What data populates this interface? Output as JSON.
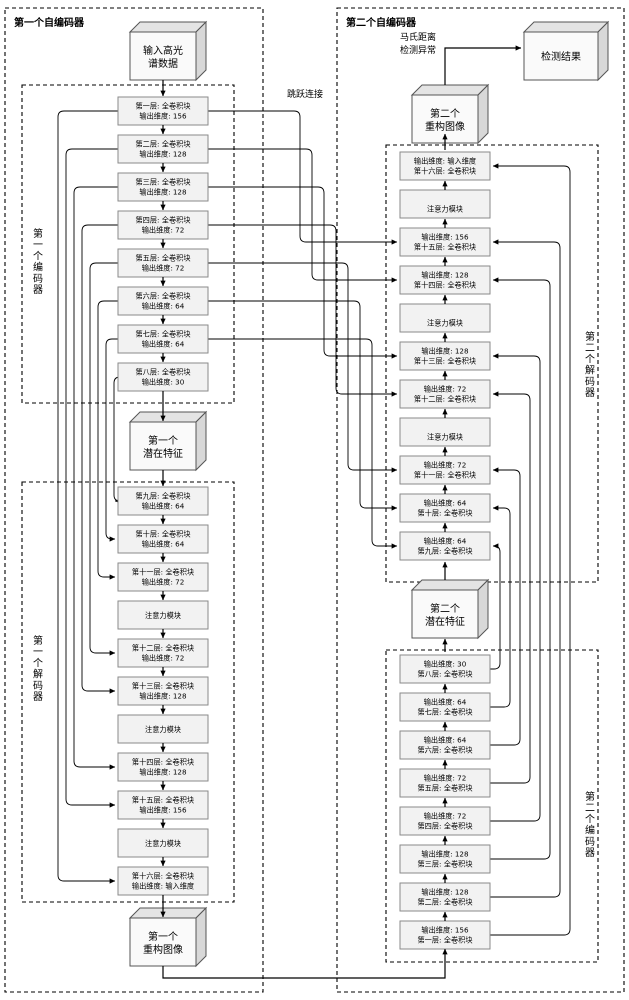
{
  "groups": {
    "autoencoder1": "第一个自编码器",
    "autoencoder2": "第二个自编码器",
    "encoder1": "第一个编码器",
    "decoder1": "第一个解码器",
    "encoder2": "第二个编码器",
    "decoder2": "第二个解码器"
  },
  "cubes": {
    "input": "输入高光\n谱数据",
    "input_l1": "输入高光",
    "input_l2": "谱数据",
    "latent1_l1": "第一个",
    "latent1_l2": "潜在特征",
    "recon1_l1": "第一个",
    "recon1_l2": "重构图像",
    "latent2_l1": "第二个",
    "latent2_l2": "潜在特征",
    "recon2_l1": "第二个",
    "recon2_l2": "重构图像",
    "result": "检测结果"
  },
  "edge_labels": {
    "skip": "跳跃连接",
    "mahalanobis_l1": "马氏距离",
    "mahalanobis_l2": "检测异常"
  },
  "common": {
    "conv_block": "全卷积块",
    "attention": "注意力模块",
    "out_dim": "输出维度",
    "in_dim": "输入维度"
  },
  "encoder1_layers": [
    {
      "name": "第一层: 全卷积块",
      "dim": "输出维度: 156"
    },
    {
      "name": "第二层: 全卷积块",
      "dim": "输出维度: 128"
    },
    {
      "name": "第三层: 全卷积块",
      "dim": "输出维度: 128"
    },
    {
      "name": "第四层: 全卷积块",
      "dim": "输出维度: 72"
    },
    {
      "name": "第五层: 全卷积块",
      "dim": "输出维度: 72"
    },
    {
      "name": "第六层: 全卷积块",
      "dim": "输出维度: 64"
    },
    {
      "name": "第七层: 全卷积块",
      "dim": "输出维度: 64"
    },
    {
      "name": "第八层: 全卷积块",
      "dim": "输出维度: 30"
    }
  ],
  "decoder1_layers": [
    {
      "name": "第九层: 全卷积块",
      "dim": "输出维度: 64"
    },
    {
      "name": "第十层: 全卷积块",
      "dim": "输出维度: 64"
    },
    {
      "name": "第十一层: 全卷积块",
      "dim": "输出维度: 72"
    },
    {
      "name": "注意力模块",
      "dim": ""
    },
    {
      "name": "第十二层: 全卷积块",
      "dim": "输出维度: 72"
    },
    {
      "name": "第十三层: 全卷积块",
      "dim": "输出维度: 128"
    },
    {
      "name": "注意力模块",
      "dim": ""
    },
    {
      "name": "第十四层: 全卷积块",
      "dim": "输出维度: 128"
    },
    {
      "name": "第十五层: 全卷积块",
      "dim": "输出维度: 156"
    },
    {
      "name": "注意力模块",
      "dim": ""
    },
    {
      "name": "第十六层: 全卷积块",
      "dim": "输出维度: 输入维度"
    }
  ],
  "decoder2_layers": [
    {
      "dim": "输出维度: 输入维度",
      "name": "第十六层: 全卷积块"
    },
    {
      "dim": "",
      "name": "注意力模块"
    },
    {
      "dim": "输出维度: 156",
      "name": "第十五层: 全卷积块"
    },
    {
      "dim": "输出维度: 128",
      "name": "第十四层: 全卷积块"
    },
    {
      "dim": "",
      "name": "注意力模块"
    },
    {
      "dim": "输出维度: 128",
      "name": "第十三层: 全卷积块"
    },
    {
      "dim": "输出维度: 72",
      "name": "第十二层: 全卷积块"
    },
    {
      "dim": "",
      "name": "注意力模块"
    },
    {
      "dim": "输出维度: 72",
      "name": "第十一层: 全卷积块"
    },
    {
      "dim": "输出维度: 64",
      "name": "第十层: 全卷积块"
    },
    {
      "dim": "输出维度: 64",
      "name": "第九层: 全卷积块"
    }
  ],
  "encoder2_layers": [
    {
      "dim": "输出维度: 30",
      "name": "第八层: 全卷积块"
    },
    {
      "dim": "输出维度: 64",
      "name": "第七层: 全卷积块"
    },
    {
      "dim": "输出维度: 64",
      "name": "第六层: 全卷积块"
    },
    {
      "dim": "输出维度: 72",
      "name": "第五层: 全卷积块"
    },
    {
      "dim": "输出维度: 72",
      "name": "第四层: 全卷积块"
    },
    {
      "dim": "输出维度: 128",
      "name": "第三层: 全卷积块"
    },
    {
      "dim": "输出维度: 128",
      "name": "第二层: 全卷积块"
    },
    {
      "dim": "输出维度: 156",
      "name": "第一层: 全卷积块"
    }
  ]
}
